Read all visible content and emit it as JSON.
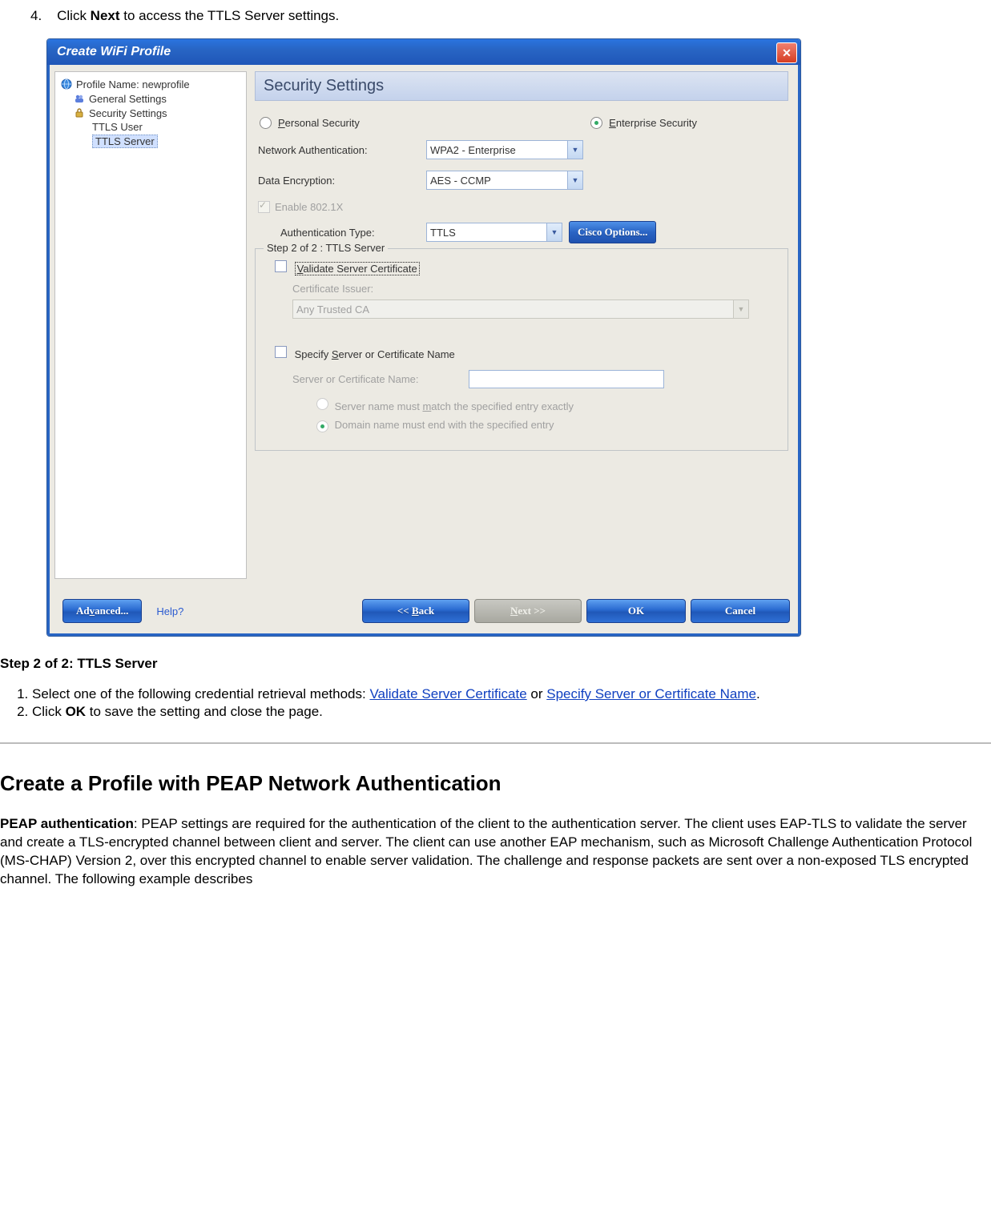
{
  "intro": {
    "number": "4.",
    "prefix": "Click ",
    "boldWord": "Next",
    "suffix": " to access the TTLS Server settings."
  },
  "window": {
    "title": "Create WiFi Profile",
    "closeGlyph": "✕"
  },
  "tree": {
    "profileName": "Profile Name: newprofile",
    "general": "General Settings",
    "security": "Security Settings",
    "ttlsUser": "TTLS User",
    "ttlsServer": "TTLS Server"
  },
  "panel": {
    "header": "Security Settings",
    "radioPersonal": "Personal Security",
    "radioEnterprise": "Enterprise Security",
    "labels": {
      "networkAuth": "Network Authentication:",
      "dataEnc": "Data Encryption:",
      "enable8021x": "Enable 802.1X",
      "authType": "Authentication Type:",
      "ciscoBtn": "Cisco Options...",
      "stepLegend": "Step 2 of 2 : TTLS Server",
      "validateCert": "Validate Server Certificate",
      "certIssuer": "Certificate Issuer:",
      "anyCA": "Any Trusted CA",
      "specifyServer": "Specify Server or Certificate Name",
      "serverCertName": "Server or Certificate Name:",
      "matchExactly": "Server name must match the specified entry exactly",
      "domainEnd": "Domain name must end with the specified entry"
    },
    "values": {
      "networkAuth": "WPA2 - Enterprise",
      "dataEnc": "AES - CCMP",
      "authType": "TTLS"
    }
  },
  "bottom": {
    "advanced": "Advanced...",
    "help": "Help?",
    "back": "<< Back",
    "next": "Next >>",
    "ok": "OK",
    "cancel": "Cancel"
  },
  "doc": {
    "stepHeader": "Step 2 of 2: TTLS Server",
    "li1a": "Select one of the following credential retrieval methods: ",
    "li1link1": "Validate Server Certificate",
    "li1mid": " or ",
    "li1link2": "Specify Server or Certificate Name",
    "li1end": ".",
    "li2a": "Click ",
    "li2bold": "OK",
    "li2b": " to save the setting and close the page.",
    "h2": "Create a Profile with PEAP Network Authentication",
    "para_bold": "PEAP authentication",
    "para_rest": ": PEAP settings are required for the authentication of the client to the authentication server. The client uses EAP-TLS to validate the server and create a TLS-encrypted channel between client and server. The client can use another EAP mechanism, such as Microsoft Challenge Authentication Protocol (MS-CHAP) Version 2, over this encrypted channel to enable server validation. The challenge and response packets are sent over a non-exposed TLS encrypted channel. The following example describes"
  }
}
